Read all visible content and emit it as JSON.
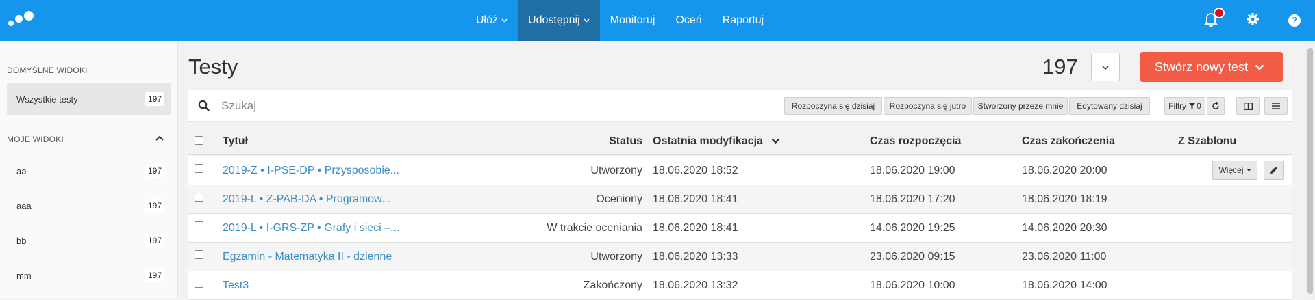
{
  "nav": {
    "items": [
      {
        "label": "Ułóż",
        "has_caret": true,
        "active": false
      },
      {
        "label": "Udostępnij",
        "has_caret": true,
        "active": true
      },
      {
        "label": "Monitoruj",
        "has_caret": false,
        "active": false
      },
      {
        "label": "Oceń",
        "has_caret": false,
        "active": false
      },
      {
        "label": "Raportuj",
        "has_caret": false,
        "active": false
      }
    ],
    "icons": [
      "bell-icon",
      "gear-icon",
      "help-icon"
    ]
  },
  "sidebar": {
    "default_views_heading": "DOMYŚLNE WIDOKI",
    "default_views": [
      {
        "label": "Wszystkie testy",
        "count": "197"
      }
    ],
    "my_views_heading": "MOJE WIDOKI",
    "my_views": [
      {
        "label": "aa",
        "count": "197"
      },
      {
        "label": "aaa",
        "count": "197"
      },
      {
        "label": "bb",
        "count": "197"
      },
      {
        "label": "mm",
        "count": "197"
      }
    ]
  },
  "header": {
    "title": "Testy",
    "total": "197",
    "create_label": "Stwórz nowy test"
  },
  "search": {
    "placeholder": "Szukaj",
    "value": "",
    "filters": [
      "Rozpoczyna się dzisiaj",
      "Rozpoczyna się jutro",
      "Stworzony przeze mnie",
      "Edytowany dzisiaj"
    ],
    "filter_button_label": "Filtry",
    "filter_count": "0"
  },
  "table": {
    "columns": {
      "title": "Tytuł",
      "status": "Status",
      "modified": "Ostatnia modyfikacja",
      "start": "Czas rozpoczęcia",
      "end": "Czas zakończenia",
      "template": "Z Szablonu"
    },
    "more_label": "Więcej",
    "rows": [
      {
        "title": "2019-Z • I-PSE-DP • Przysposobie...",
        "status": "Utworzony",
        "modified": "18.06.2020 18:52",
        "start": "18.06.2020 19:00",
        "end": "18.06.2020 20:00"
      },
      {
        "title": "2019-L • Z-PAB-DA • Programow...",
        "status": "Oceniony",
        "modified": "18.06.2020 18:41",
        "start": "18.06.2020 17:20",
        "end": "18.06.2020 18:19"
      },
      {
        "title": "2019-L • I-GRS-ZP • Grafy i sieci –...",
        "status": "W trakcie oceniania",
        "modified": "18.06.2020 18:41",
        "start": "14.06.2020 19:25",
        "end": "14.06.2020 20:30"
      },
      {
        "title": "Egzamin - Matematyka II - dzienne",
        "status": "Utworzony",
        "modified": "18.06.2020 13:33",
        "start": "23.06.2020 09:15",
        "end": "23.06.2020 11:00"
      },
      {
        "title": "Test3",
        "status": "Zakończony",
        "modified": "18.06.2020 13:32",
        "start": "18.06.2020 10:00",
        "end": "18.06.2020 14:00"
      }
    ]
  },
  "colors": {
    "topbar": "#1596ec",
    "active_nav": "#1f6fa4",
    "primary_button": "#f25c47",
    "link": "#3a8dc3",
    "notification": "#d60f1e"
  }
}
